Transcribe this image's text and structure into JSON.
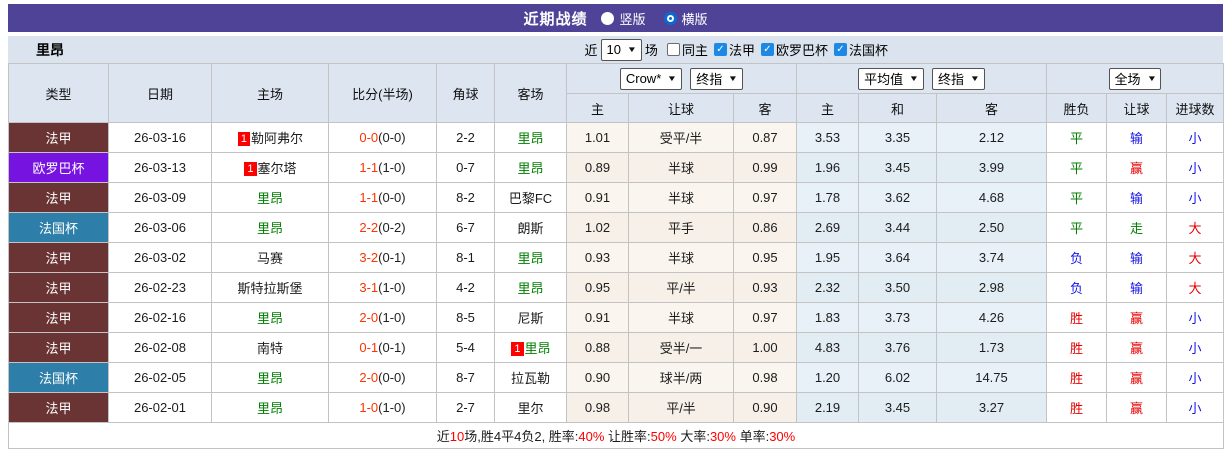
{
  "titlebar": {
    "title": "近期战绩",
    "radios": [
      {
        "label": "竖版",
        "checked": false
      },
      {
        "label": "横版",
        "checked": true
      }
    ]
  },
  "filterbar": {
    "team": "里昂",
    "recent_label": "近",
    "recent_count": "10",
    "games_label": "场",
    "checkboxes": [
      {
        "label": "同主",
        "checked": false
      },
      {
        "label": "法甲",
        "checked": true
      },
      {
        "label": "欧罗巴杯",
        "checked": true
      },
      {
        "label": "法国杯",
        "checked": true
      }
    ]
  },
  "table": {
    "static_headers": [
      "类型",
      "日期",
      "主场",
      "比分(半场)",
      "角球",
      "客场"
    ],
    "groups": [
      {
        "dropdowns": [
          "Crow*",
          "终指"
        ],
        "subcols": [
          "主",
          "让球",
          "客"
        ]
      },
      {
        "dropdowns": [
          "平均值",
          "终指"
        ],
        "subcols": [
          "主",
          "和",
          "客"
        ]
      },
      {
        "dropdowns": [
          "全场"
        ],
        "subcols": [
          "胜负",
          "让球",
          "进球数"
        ]
      }
    ],
    "league_colors": {
      "法甲": "#6a3434",
      "欧罗巴杯": "#7713e1",
      "法国杯": "#2d7ea9"
    },
    "outcome_colors": {
      "red": "#e60000",
      "green": "#008000",
      "blue": "#1414e6"
    },
    "rows": [
      {
        "league": "法甲",
        "date": "26-03-16",
        "home": {
          "badge": "1",
          "name": "勒阿弗尔",
          "team": false
        },
        "score_ft": "0-0",
        "score_ht": "(0-0)",
        "corners": "2-2",
        "away": {
          "badge": "",
          "name": "里昂",
          "team": true
        },
        "odds": [
          "1.01",
          "受平/半",
          "0.87"
        ],
        "avg": [
          "3.53",
          "3.35",
          "2.12"
        ],
        "results": [
          [
            "平",
            "green"
          ],
          [
            "输",
            "blue"
          ],
          [
            "小",
            "blue"
          ]
        ]
      },
      {
        "league": "欧罗巴杯",
        "date": "26-03-13",
        "home": {
          "badge": "1",
          "name": "塞尔塔",
          "team": false
        },
        "score_ft": "1-1",
        "score_ht": "(1-0)",
        "corners": "0-7",
        "away": {
          "badge": "",
          "name": "里昂",
          "team": true
        },
        "odds": [
          "0.89",
          "半球",
          "0.99"
        ],
        "avg": [
          "1.96",
          "3.45",
          "3.99"
        ],
        "results": [
          [
            "平",
            "green"
          ],
          [
            "赢",
            "red"
          ],
          [
            "小",
            "blue"
          ]
        ]
      },
      {
        "league": "法甲",
        "date": "26-03-09",
        "home": {
          "badge": "",
          "name": "里昂",
          "team": true
        },
        "score_ft": "1-1",
        "score_ht": "(0-0)",
        "corners": "8-2",
        "away": {
          "badge": "",
          "name": "巴黎FC",
          "team": false
        },
        "odds": [
          "0.91",
          "半球",
          "0.97"
        ],
        "avg": [
          "1.78",
          "3.62",
          "4.68"
        ],
        "results": [
          [
            "平",
            "green"
          ],
          [
            "输",
            "blue"
          ],
          [
            "小",
            "blue"
          ]
        ]
      },
      {
        "league": "法国杯",
        "date": "26-03-06",
        "home": {
          "badge": "",
          "name": "里昂",
          "team": true
        },
        "score_ft": "2-2",
        "score_ht": "(0-2)",
        "corners": "6-7",
        "away": {
          "badge": "",
          "name": "朗斯",
          "team": false
        },
        "odds": [
          "1.02",
          "平手",
          "0.86"
        ],
        "avg": [
          "2.69",
          "3.44",
          "2.50"
        ],
        "results": [
          [
            "平",
            "green"
          ],
          [
            "走",
            "green"
          ],
          [
            "大",
            "red"
          ]
        ]
      },
      {
        "league": "法甲",
        "date": "26-03-02",
        "home": {
          "badge": "",
          "name": "马赛",
          "team": false
        },
        "score_ft": "3-2",
        "score_ht": "(0-1)",
        "corners": "8-1",
        "away": {
          "badge": "",
          "name": "里昂",
          "team": true
        },
        "odds": [
          "0.93",
          "半球",
          "0.95"
        ],
        "avg": [
          "1.95",
          "3.64",
          "3.74"
        ],
        "results": [
          [
            "负",
            "blue"
          ],
          [
            "输",
            "blue"
          ],
          [
            "大",
            "red"
          ]
        ]
      },
      {
        "league": "法甲",
        "date": "26-02-23",
        "home": {
          "badge": "",
          "name": "斯特拉斯堡",
          "team": false
        },
        "score_ft": "3-1",
        "score_ht": "(1-0)",
        "corners": "4-2",
        "away": {
          "badge": "",
          "name": "里昂",
          "team": true
        },
        "odds": [
          "0.95",
          "平/半",
          "0.93"
        ],
        "avg": [
          "2.32",
          "3.50",
          "2.98"
        ],
        "results": [
          [
            "负",
            "blue"
          ],
          [
            "输",
            "blue"
          ],
          [
            "大",
            "red"
          ]
        ]
      },
      {
        "league": "法甲",
        "date": "26-02-16",
        "home": {
          "badge": "",
          "name": "里昂",
          "team": true
        },
        "score_ft": "2-0",
        "score_ht": "(1-0)",
        "corners": "8-5",
        "away": {
          "badge": "",
          "name": "尼斯",
          "team": false
        },
        "odds": [
          "0.91",
          "半球",
          "0.97"
        ],
        "avg": [
          "1.83",
          "3.73",
          "4.26"
        ],
        "results": [
          [
            "胜",
            "red"
          ],
          [
            "赢",
            "red"
          ],
          [
            "小",
            "blue"
          ]
        ]
      },
      {
        "league": "法甲",
        "date": "26-02-08",
        "home": {
          "badge": "",
          "name": "南特",
          "team": false
        },
        "score_ft": "0-1",
        "score_ht": "(0-1)",
        "corners": "5-4",
        "away": {
          "badge": "1",
          "name": "里昂",
          "team": true
        },
        "odds": [
          "0.88",
          "受半/一",
          "1.00"
        ],
        "avg": [
          "4.83",
          "3.76",
          "1.73"
        ],
        "results": [
          [
            "胜",
            "red"
          ],
          [
            "赢",
            "red"
          ],
          [
            "小",
            "blue"
          ]
        ]
      },
      {
        "league": "法国杯",
        "date": "26-02-05",
        "home": {
          "badge": "",
          "name": "里昂",
          "team": true
        },
        "score_ft": "2-0",
        "score_ht": "(0-0)",
        "corners": "8-7",
        "away": {
          "badge": "",
          "name": "拉瓦勒",
          "team": false
        },
        "odds": [
          "0.90",
          "球半/两",
          "0.98"
        ],
        "avg": [
          "1.20",
          "6.02",
          "14.75"
        ],
        "results": [
          [
            "胜",
            "red"
          ],
          [
            "赢",
            "red"
          ],
          [
            "小",
            "blue"
          ]
        ]
      },
      {
        "league": "法甲",
        "date": "26-02-01",
        "home": {
          "badge": "",
          "name": "里昂",
          "team": true
        },
        "score_ft": "1-0",
        "score_ht": "(1-0)",
        "corners": "2-7",
        "away": {
          "badge": "",
          "name": "里尔",
          "team": false
        },
        "odds": [
          "0.98",
          "平/半",
          "0.90"
        ],
        "avg": [
          "2.19",
          "3.45",
          "3.27"
        ],
        "results": [
          [
            "胜",
            "red"
          ],
          [
            "赢",
            "red"
          ],
          [
            "小",
            "blue"
          ]
        ]
      }
    ]
  },
  "summary": {
    "segments": [
      {
        "text": "近",
        "red": false
      },
      {
        "text": "10",
        "red": true
      },
      {
        "text": "场,胜4平4负2, 胜率:",
        "red": false
      },
      {
        "text": "40%",
        "red": true
      },
      {
        "text": " 让胜率:",
        "red": false
      },
      {
        "text": "50%",
        "red": true
      },
      {
        "text": " 大率:",
        "red": false
      },
      {
        "text": "30%",
        "red": true
      },
      {
        "text": " 单率:",
        "red": false
      },
      {
        "text": "30%",
        "red": true
      }
    ]
  }
}
